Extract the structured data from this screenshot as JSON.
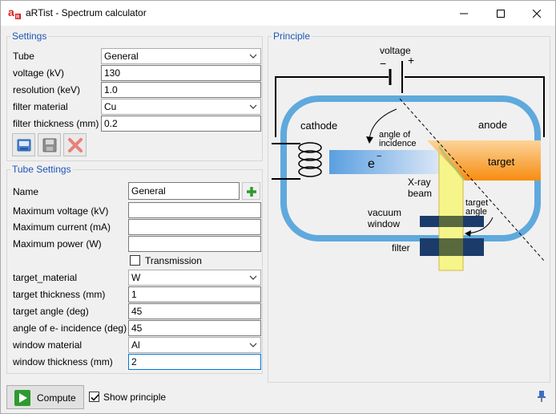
{
  "window": {
    "title": "aRTist - Spectrum calculator"
  },
  "settings": {
    "legend": "Settings",
    "tube": {
      "label": "Tube",
      "value": "General"
    },
    "voltage": {
      "label": "voltage (kV)",
      "value": "130"
    },
    "resolution": {
      "label": "resolution (keV)",
      "value": "1.0"
    },
    "filter_material": {
      "label": "filter material",
      "value": "Cu"
    },
    "filter_thickness": {
      "label": "filter thickness (mm)",
      "value": "0.2"
    }
  },
  "tube_settings": {
    "legend": "Tube Settings",
    "name": {
      "label": "Name",
      "value": "General"
    },
    "max_voltage": {
      "label": "Maximum voltage (kV)",
      "value": ""
    },
    "max_current": {
      "label": "Maximum current (mA)",
      "value": ""
    },
    "max_power": {
      "label": "Maximum power (W)",
      "value": ""
    },
    "transmission": {
      "label": "Transmission",
      "checked": false
    },
    "target_material": {
      "label": "target_material",
      "value": "W"
    },
    "target_thickness": {
      "label": "target thickness (mm)",
      "value": "1"
    },
    "target_angle": {
      "label": "target angle (deg)",
      "value": "45"
    },
    "incidence_angle": {
      "label": "angle of e- incidence (deg)",
      "value": "45"
    },
    "window_material": {
      "label": "window material",
      "value": "Al"
    },
    "window_thickness": {
      "label": "window thickness (mm)",
      "value": "2"
    }
  },
  "principle": {
    "legend": "Principle",
    "voltage": "voltage",
    "minus": "−",
    "plus": "+",
    "cathode": "cathode",
    "anode": "anode",
    "angle_of_incidence_1": "angle of",
    "angle_of_incidence_2": "incidence",
    "electron": "e",
    "electron_sup": "−",
    "target": "target",
    "xray_1": "X-ray",
    "xray_2": "beam",
    "target_angle_1": "target",
    "target_angle_2": "angle",
    "vacuum_1": "vacuum",
    "vacuum_2": "window",
    "filter": "filter"
  },
  "footer": {
    "compute": "Compute",
    "show_principle": {
      "label": "Show principle",
      "checked": true
    }
  },
  "colors": {
    "accent": "#1f56b9",
    "tube": "#5fa9dd",
    "beam": "#f5f58a",
    "target": "#f7981d"
  },
  "icons": [
    "app-logo-icon",
    "minimize-icon",
    "maximize-icon",
    "close-icon",
    "load-icon",
    "save-icon",
    "delete-icon",
    "add-icon",
    "play-icon",
    "pin-icon"
  ]
}
